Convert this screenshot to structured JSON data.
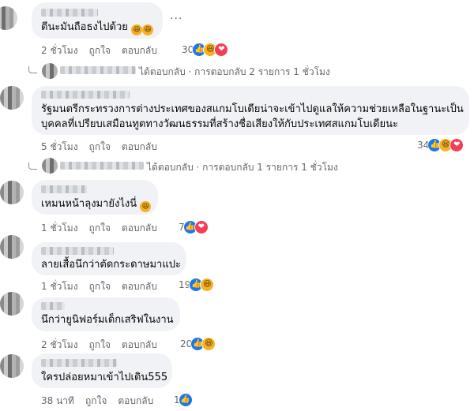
{
  "comments": [
    {
      "text": "ตีนะมันถือธงไปด้วย",
      "emoji": [
        "haha",
        "haha"
      ],
      "time": "2 ชั่วโมง",
      "like_label": "ถูกใจ",
      "reply_label": "ตอบกลับ",
      "reaction_count": "30",
      "reactions": [
        "like",
        "haha",
        "love"
      ],
      "more_label": "..."
    },
    {
      "text": "รัฐมนตรีกระทรวงการต่างประเทศของสแกมโบเดียน่าจะเข้าไปดูแลให้ความช่วยเหลือในฐานะเป็นบุคคลที่เปรียบเสมือนทูตทางวัฒนธรรมที่สร้างชื่อเสียงให้กับประเทศสแกมโบเดียนะ",
      "time": "5 ชั่วโมง",
      "like_label": "ถูกใจ",
      "reply_label": "ตอบกลับ",
      "reaction_count": "34",
      "reactions": [
        "like",
        "haha",
        "love"
      ]
    },
    {
      "text": "เหมนหน้าลุงมายังไงนี่",
      "emoji": [
        "haha"
      ],
      "time": "1 ชั่วโมง",
      "like_label": "ถูกใจ",
      "reply_label": "ตอบกลับ",
      "reaction_count": "7",
      "reactions": [
        "like",
        "love"
      ]
    },
    {
      "text": "ลายเสื้อนึกว่าตัดกระดาษมาแปะ",
      "time": "1 ชั่วโมง",
      "like_label": "ถูกใจ",
      "reply_label": "ตอบกลับ",
      "reaction_count": "19",
      "reactions": [
        "like",
        "haha"
      ]
    },
    {
      "text": "นึกว่ายูนิฟอร์มเด็กเสริฟในงาน",
      "time": "2 ชั่วโมง",
      "like_label": "ถูกใจ",
      "reply_label": "ตอบกลับ",
      "reaction_count": "20",
      "reactions": [
        "like",
        "haha"
      ]
    },
    {
      "text": "ใครปล่อยหมาเข้าไปเดิน555",
      "time": "38 นาที",
      "like_label": "ถูกใจ",
      "reply_label": "ตอบกลับ",
      "reaction_count": "1",
      "reactions": [
        "like"
      ]
    }
  ],
  "reply_threads": [
    {
      "replied_text": "ได้ตอบกลับ",
      "separator": "·",
      "count_text": "การตอบกลับ 2 รายการ",
      "time": "1 ชั่วโมง"
    },
    {
      "replied_text": "ได้ตอบกลับ",
      "separator": "·",
      "count_text": "การตอบกลับ 1 รายการ",
      "time": "1 ชั่วโมง"
    }
  ],
  "colors": {
    "bubble": "#f0f2f5",
    "meta_text": "#65676b",
    "like": "#1877f2",
    "haha": "#f7b125",
    "love": "#f33e58"
  }
}
